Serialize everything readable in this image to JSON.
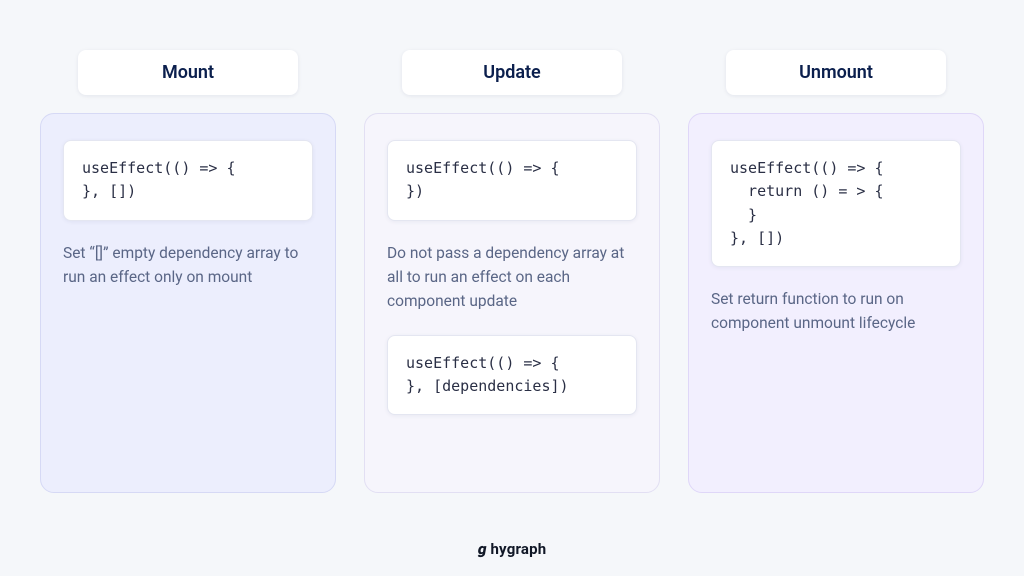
{
  "columns": {
    "mount": {
      "title": "Mount",
      "code1": "useEffect(() => {\n}, [])",
      "desc": "Set “[]” empty dependency array to run an effect only on mount"
    },
    "update": {
      "title": "Update",
      "code1": "useEffect(() => {\n})",
      "desc": "Do not pass a dependency array at all to run an effect on each component update",
      "code2": "useEffect(() => {\n}, [dependencies])"
    },
    "unmount": {
      "title": "Unmount",
      "code1": "useEffect(() => {\n  return () = > {\n  }\n}, [])",
      "desc": "Set return function to run on component unmount lifecycle"
    }
  },
  "brand": "hygraph"
}
